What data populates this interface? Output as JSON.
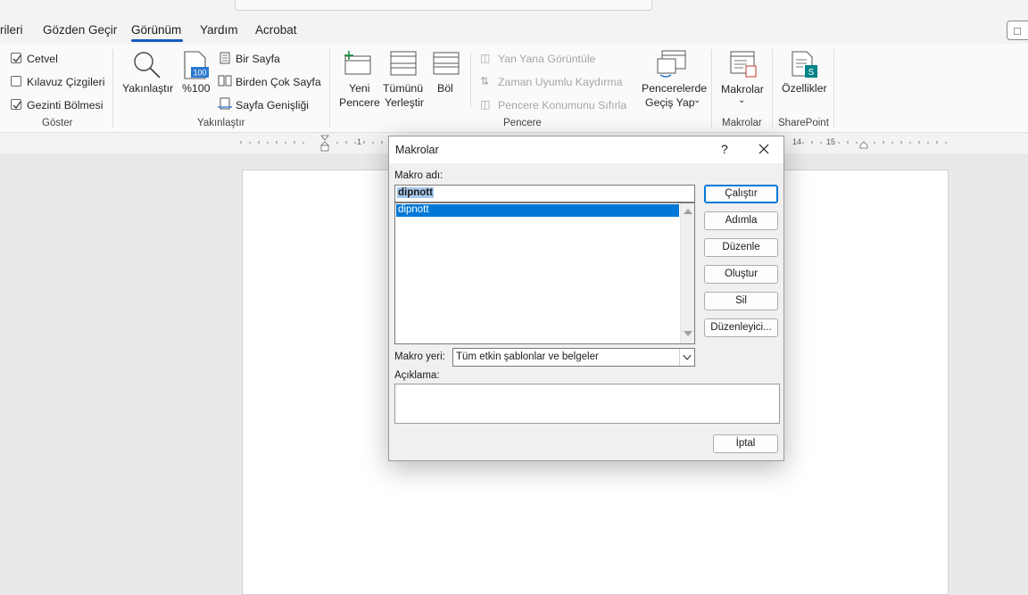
{
  "tabs": [
    {
      "label": "rileri",
      "active": false
    },
    {
      "label": "Gözden Geçir",
      "active": false
    },
    {
      "label": "Görünüm",
      "active": true
    },
    {
      "label": "Yardım",
      "active": false
    },
    {
      "label": "Acrobat",
      "active": false
    }
  ],
  "ribbon": {
    "goster": {
      "checks": [
        {
          "label": "Cetvel",
          "checked": true
        },
        {
          "label": "Kılavuz Çizgileri",
          "checked": false
        },
        {
          "label": "Gezinti Bölmesi",
          "checked": true
        }
      ],
      "group_label": "Göster"
    },
    "yakinlastir": {
      "zoom_label": "Yakınlaştır",
      "zoom100_label": "%100",
      "zoom100_badge": "100",
      "one_page": "Bir Sayfa",
      "multi_page": "Birden Çok Sayfa",
      "page_width": "Sayfa Genişliği",
      "group_label": "Yakınlaştır"
    },
    "pencere": {
      "new_window_1": "Yeni",
      "new_window_2": "Pencere",
      "arrange_1": "Tümünü",
      "arrange_2": "Yerleştir",
      "split": "Böl",
      "side_by_side": "Yan Yana Görüntüle",
      "sync_scroll": "Zaman Uyumlu Kaydırma",
      "reset_pos": "Pencere Konumunu Sıfırla",
      "switch_1": "Pencerelerde",
      "switch_2": "Geçiş Yap",
      "group_label": "Pencere"
    },
    "makrolar": {
      "label": "Makrolar",
      "group_label": "Makrolar"
    },
    "sharepoint": {
      "label": "Özellikler",
      "group_label": "SharePoint"
    }
  },
  "ruler": {
    "ticks": [
      "1",
      "14",
      "15"
    ]
  },
  "dialog": {
    "title": "Makrolar",
    "help": "?",
    "name_label": "Makro adı:",
    "name_value": "dipnott",
    "list_items": [
      "dipnott"
    ],
    "location_label": "Makro yeri:",
    "location_value": "Tüm etkin şablonlar ve belgeler",
    "description_label": "Açıklama:",
    "buttons": {
      "run": "Çalıştır",
      "step": "Adımla",
      "edit": "Düzenle",
      "create": "Oluştur",
      "delete": "Sil",
      "organizer": "Düzenleyici...",
      "cancel": "İptal"
    }
  }
}
